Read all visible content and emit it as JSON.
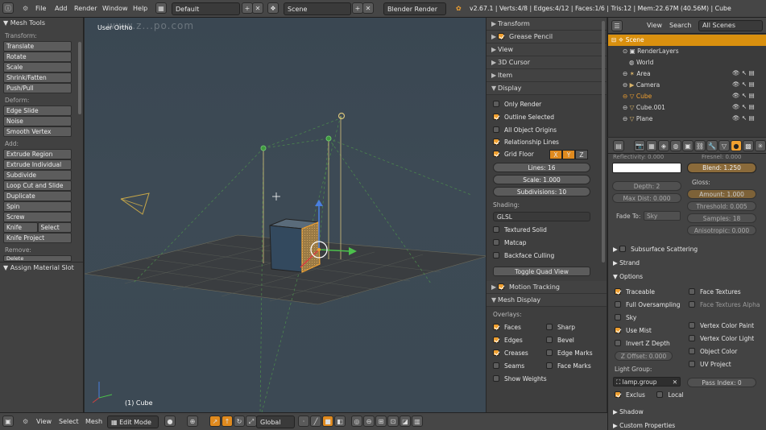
{
  "topbar": {
    "menus": [
      "File",
      "Add",
      "Render",
      "Window",
      "Help"
    ],
    "layout_name": "Default",
    "scene_name": "Scene",
    "render_engine": "Blender Render",
    "stats": "v2.67.1 | Verts:4/8 | Edges:4/12 | Faces:1/6 | Tris:12 | Mem:22.67M (40.56M) | Cube",
    "watermark": "www.z...po.com"
  },
  "toolshelf": {
    "title": "Mesh Tools",
    "transform_label": "Transform:",
    "transform": [
      "Translate",
      "Rotate",
      "Scale",
      "Shrink/Fatten",
      "Push/Pull"
    ],
    "deform_label": "Deform:",
    "deform": [
      "Edge Slide",
      "Noise",
      "Smooth Vertex"
    ],
    "add_label": "Add:",
    "add": [
      "Extrude Region",
      "Extrude Individual",
      "Subdivide",
      "Loop Cut and Slide",
      "Duplicate",
      "Spin",
      "Screw"
    ],
    "knife": "Knife",
    "select": "Select",
    "knife_project": "Knife Project",
    "remove_label": "Remove:",
    "delete": "Delete",
    "assign_material": "Assign Material Slot"
  },
  "viewport": {
    "view_label": "User Ortho",
    "object_label": "(1) Cube"
  },
  "npanel": {
    "transform": "Transform",
    "grease_pencil": "Grease Pencil",
    "view": "View",
    "cursor": "3D Cursor",
    "item": "Item",
    "display": "Display",
    "only_render": "Only Render",
    "outline_selected": "Outline Selected",
    "all_object_origins": "All Object Origins",
    "relationship_lines": "Relationship Lines",
    "grid_floor": "Grid Floor",
    "axis_x": "X",
    "axis_y": "Y",
    "axis_z": "Z",
    "lines": "Lines: 16",
    "scale": "Scale: 1.000",
    "subdivisions": "Subdivisions: 10",
    "shading_label": "Shading:",
    "shading_mode": "GLSL",
    "textured_solid": "Textured Solid",
    "matcap": "Matcap",
    "backface_culling": "Backface Culling",
    "toggle_quad_view": "Toggle Quad View",
    "motion_tracking": "Motion Tracking",
    "mesh_display": "Mesh Display",
    "overlays_label": "Overlays:",
    "faces": "Faces",
    "sharp": "Sharp",
    "edges": "Edges",
    "bevel": "Bevel",
    "creases": "Creases",
    "edge_marks": "Edge Marks",
    "seams": "Seams",
    "face_marks": "Face Marks",
    "show_weights": "Show Weights"
  },
  "outliner": {
    "view": "View",
    "search": "Search",
    "scenes": "All Scenes",
    "items": [
      "Scene",
      "RenderLayers",
      "World",
      "Area",
      "Camera",
      "Cube",
      "Cube.001",
      "Plane"
    ]
  },
  "props": {
    "reflectivity": "Reflectivity: 0.000",
    "fresnel": "Fresnel: 0.000",
    "blend": "Blend: 1.250",
    "depth": "Depth: 2",
    "max_dist": "Max Dist: 0.000",
    "gloss_label": "Gloss:",
    "amount": "Amount: 1.000",
    "threshold": "Threshold: 0.005",
    "fade_to_label": "Fade To:",
    "fade_to_value": "Sky",
    "samples": "Samples: 18",
    "anisotropic": "Anisotropic: 0.000",
    "subsurface": "Subsurface Scattering",
    "strand": "Strand",
    "options": "Options",
    "traceable": "Traceable",
    "face_textures": "Face Textures",
    "full_oversampling": "Full Oversampling",
    "face_textures_alpha": "Face Textures Alpha",
    "sky": "Sky",
    "use_mist": "Use Mist",
    "vertex_color_paint": "Vertex Color Paint",
    "invert_z": "Invert Z Depth",
    "vertex_color_light": "Vertex Color Light",
    "z_offset": "Z Offset: 0.000",
    "object_color": "Object Color",
    "uv_project": "UV Project",
    "light_group_label": "Light Group:",
    "light_group": "lamp.group",
    "pass_index": "Pass Index: 0",
    "exclus": "Exclus",
    "local": "Local",
    "shadow": "Shadow",
    "custom_props": "Custom Properties"
  },
  "bottombar": {
    "view": "View",
    "select": "Select",
    "mesh": "Mesh",
    "mode": "Edit Mode",
    "orientation": "Global"
  },
  "colors": {
    "accent": "#f0a030",
    "selected_row": "#d9900f",
    "viewport_bg": "#3c4954"
  }
}
